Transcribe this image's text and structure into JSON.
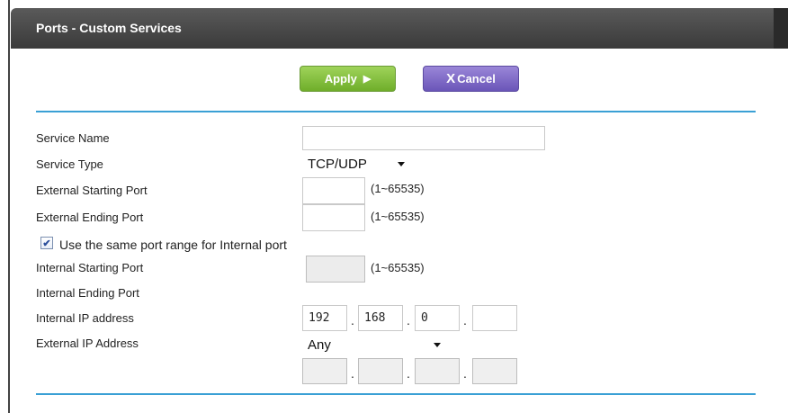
{
  "header": {
    "title": "Ports - Custom Services"
  },
  "toolbar": {
    "apply_label": "Apply",
    "apply_symbol": "▶",
    "cancel_symbol": "X",
    "cancel_label": "Cancel"
  },
  "form": {
    "service_name": {
      "label": "Service Name",
      "value": ""
    },
    "service_type": {
      "label": "Service Type",
      "selected": "TCP/UDP"
    },
    "external_starting_port": {
      "label": "External Starting Port",
      "value": "",
      "hint": "(1~65535)"
    },
    "external_ending_port": {
      "label": "External Ending Port",
      "value": "",
      "hint": "(1~65535)"
    },
    "same_range": {
      "label": "Use the same port range for Internal port",
      "checked": true
    },
    "internal_starting_port": {
      "label": "Internal Starting Port",
      "value": "",
      "hint": "(1~65535)"
    },
    "internal_ending_port": {
      "label": "Internal Ending Port"
    },
    "internal_ip": {
      "label": "Internal IP address",
      "octets": [
        "192",
        "168",
        "0",
        ""
      ]
    },
    "external_ip": {
      "label": "External IP Address",
      "selected": "Any",
      "octets": [
        "",
        "",
        "",
        ""
      ]
    }
  }
}
